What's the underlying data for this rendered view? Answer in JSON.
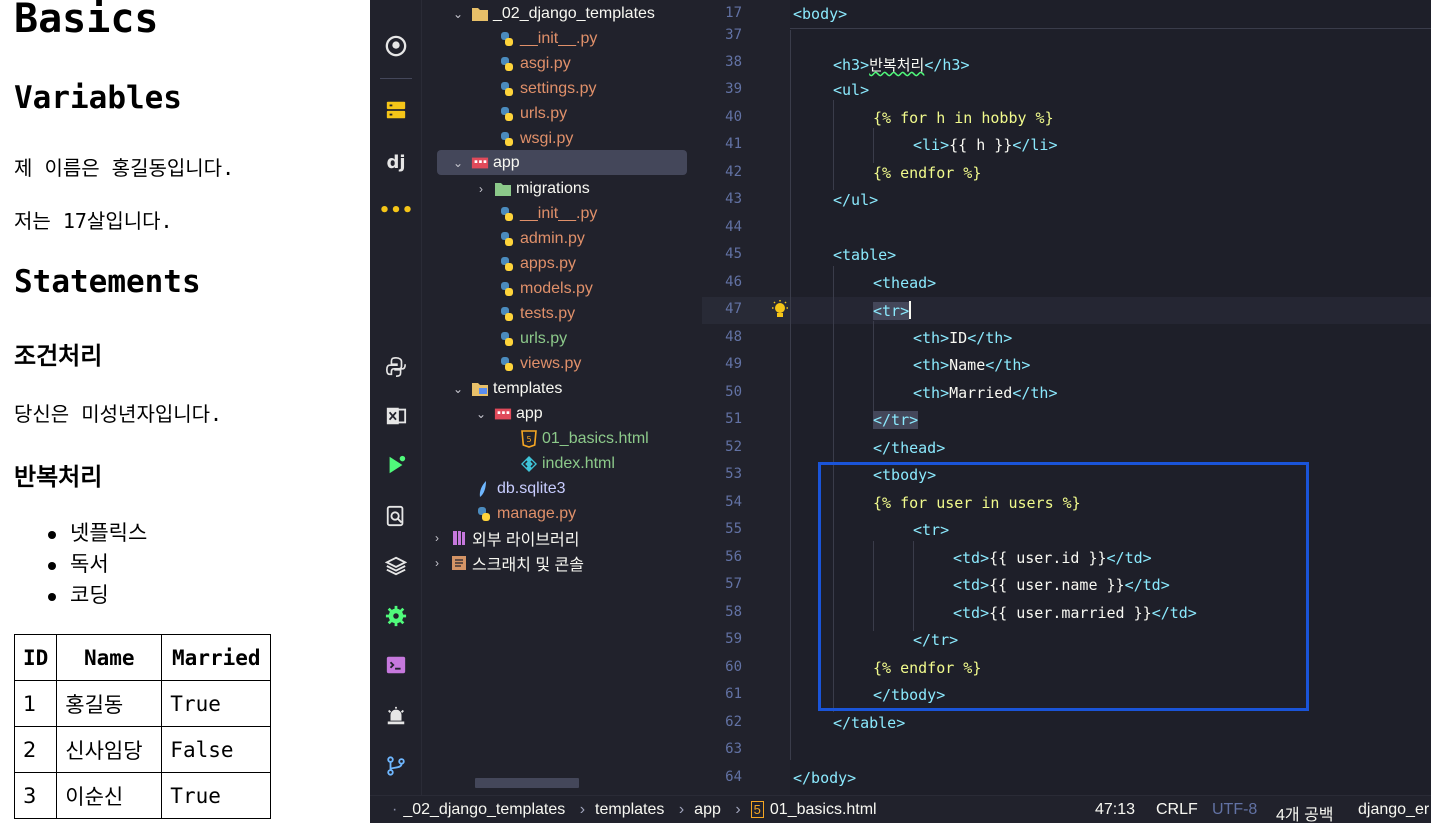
{
  "preview": {
    "h1": "Basics",
    "variables_heading": "Variables",
    "name_line": "제 이름은 홍길동입니다.",
    "age_line": "저는 17살입니다.",
    "statements_heading": "Statements",
    "condition_heading": "조건처리",
    "condition_line": "당신은 미성년자입니다.",
    "loop_heading": "반복처리",
    "hobbies": [
      "넷플릭스",
      "독서",
      "코딩"
    ],
    "table_headers": [
      "ID",
      "Name",
      "Married"
    ],
    "table_rows": [
      [
        "1",
        "홍길동",
        "True"
      ],
      [
        "2",
        "신사임당",
        "False"
      ],
      [
        "3",
        "이순신",
        "True"
      ]
    ]
  },
  "explorer": {
    "items": [
      {
        "label": "_02_django_templates",
        "type": "folder"
      },
      {
        "label": "__init__.py",
        "type": "py"
      },
      {
        "label": "asgi.py",
        "type": "py"
      },
      {
        "label": "settings.py",
        "type": "py"
      },
      {
        "label": "urls.py",
        "type": "py"
      },
      {
        "label": "wsgi.py",
        "type": "py"
      },
      {
        "label": "app",
        "type": "package"
      },
      {
        "label": "migrations",
        "type": "folder"
      },
      {
        "label": "__init__.py",
        "type": "py"
      },
      {
        "label": "admin.py",
        "type": "py"
      },
      {
        "label": "apps.py",
        "type": "py"
      },
      {
        "label": "models.py",
        "type": "py"
      },
      {
        "label": "tests.py",
        "type": "py"
      },
      {
        "label": "urls.py",
        "type": "py"
      },
      {
        "label": "views.py",
        "type": "py"
      },
      {
        "label": "templates",
        "type": "folder"
      },
      {
        "label": "app",
        "type": "package"
      },
      {
        "label": "01_basics.html",
        "type": "html5"
      },
      {
        "label": "index.html",
        "type": "html"
      },
      {
        "label": "db.sqlite3",
        "type": "db"
      },
      {
        "label": "manage.py",
        "type": "py"
      },
      {
        "label": "외부 라이브러리",
        "type": "lib"
      },
      {
        "label": "스크래치 및 콘솔",
        "type": "scratch"
      }
    ]
  },
  "editor": {
    "line_numbers": [
      "17",
      "37",
      "38",
      "39",
      "40",
      "41",
      "42",
      "43",
      "44",
      "45",
      "46",
      "47",
      "48",
      "49",
      "50",
      "51",
      "52",
      "53",
      "54",
      "55",
      "56",
      "57",
      "58",
      "59",
      "60",
      "61",
      "62",
      "63",
      "64"
    ],
    "lines": [
      [
        "<body>"
      ],
      [
        ""
      ],
      [
        "<h3>",
        "반복처리",
        "</h3>"
      ],
      [
        "<ul>"
      ],
      [
        "{% for h in hobby %}"
      ],
      [
        "<li>",
        "{{ h }}",
        "</li>"
      ],
      [
        "{% endfor %}"
      ],
      [
        "</ul>"
      ],
      [
        ""
      ],
      [
        "<table>"
      ],
      [
        "<thead>"
      ],
      [
        "<tr>"
      ],
      [
        "<th>",
        "ID",
        "</th>"
      ],
      [
        "<th>",
        "Name",
        "</th>"
      ],
      [
        "<th>",
        "Married",
        "</th>"
      ],
      [
        "</tr>"
      ],
      [
        "</thead>"
      ],
      [
        "<tbody>"
      ],
      [
        "{% for user in users %}"
      ],
      [
        "<tr>"
      ],
      [
        "<td>",
        "{{ user.id }}",
        "</td>"
      ],
      [
        "<td>",
        "{{ user.name }}",
        "</td>"
      ],
      [
        "<td>",
        "{{ user.married }}",
        "</td>"
      ],
      [
        "</tr>"
      ],
      [
        "{% endfor %}"
      ],
      [
        "</tbody>"
      ],
      [
        "</table>"
      ],
      [
        ""
      ],
      [
        "</body>"
      ]
    ]
  },
  "statusbar": {
    "breadcrumb": [
      "_02_django_templates",
      "templates",
      "app",
      "01_basics.html"
    ],
    "position": "47:13",
    "line_ending": "CRLF",
    "encoding": "UTF-8",
    "indent": "4개 공백",
    "interpreter": "django_er"
  },
  "colors": {
    "highlight_box": "#1a54d8",
    "editor_bg": "#1e1f29",
    "tag": "#8be9fd",
    "template": "#f1fa8c"
  }
}
